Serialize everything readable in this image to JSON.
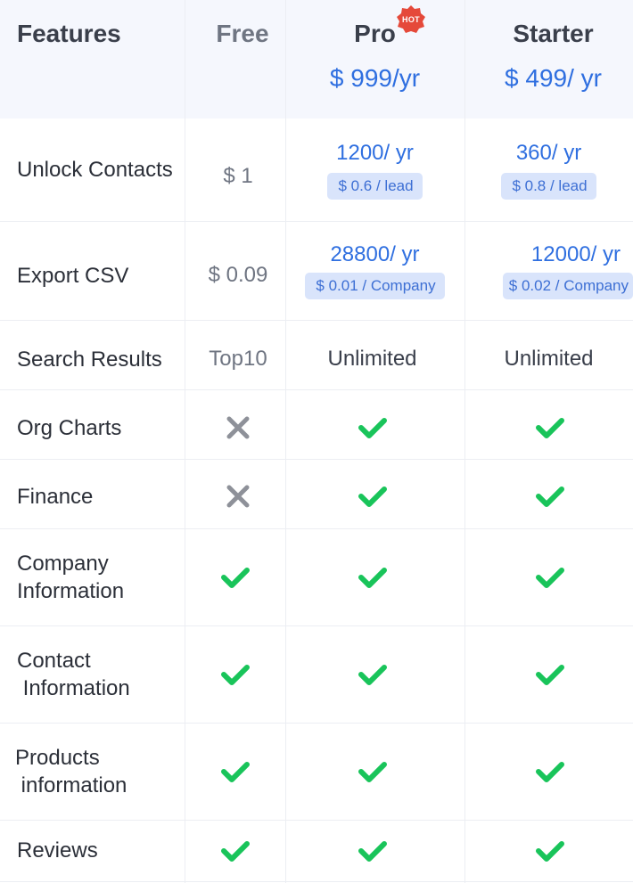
{
  "header": {
    "features_label": "Features",
    "free_label": "Free",
    "pro_label": "Pro",
    "pro_badge": "HOT",
    "pro_price": "$ 999/yr",
    "starter_label": "Starter",
    "starter_price": "$ 499/ yr"
  },
  "rows": {
    "unlock_contacts": {
      "label": "Unlock Contacts",
      "free": "$ 1",
      "pro": "1200/ yr",
      "pro_chip": "$ 0.6 / lead",
      "starter": "360/ yr",
      "starter_chip": "$ 0.8 / lead"
    },
    "export_csv": {
      "label": "Export CSV",
      "free": "$ 0.09",
      "pro": "28800/ yr",
      "pro_chip": "$ 0.01 / Company",
      "starter": "12000/ yr",
      "starter_chip": "$ 0.02 / Company"
    },
    "search_results": {
      "label": "Search Results",
      "free": "Top10",
      "pro": "Unlimited",
      "starter": "Unlimited"
    },
    "org_charts": {
      "label": "Org Charts",
      "free": "cross-icon",
      "pro": "check-icon",
      "starter": "check-icon"
    },
    "finance": {
      "label": "Finance",
      "free": "cross-icon",
      "pro": "check-icon",
      "starter": "check-icon"
    },
    "company_information": {
      "label_line1": "Company",
      "label_line2": "Information",
      "free": "check-icon",
      "pro": "check-icon",
      "starter": "check-icon"
    },
    "contact_information": {
      "label_line1": "Contact",
      "label_line2": " Information",
      "free": "check-icon",
      "pro": "check-icon",
      "starter": "check-icon"
    },
    "products_information": {
      "label_line1": "Products",
      "label_line2": " information",
      "free": "check-icon",
      "pro": "check-icon",
      "starter": "check-icon"
    },
    "reviews": {
      "label": "Reviews",
      "free": "check-icon",
      "pro": "check-icon",
      "starter": "check-icon"
    }
  },
  "colors": {
    "header_bg": "#f5f7fd",
    "accent_blue": "#2f6fe0",
    "chip_bg": "#d9e4fb",
    "check_green": "#19c45a",
    "cross_gray": "#8e9199",
    "hot_red": "#e5493a"
  }
}
